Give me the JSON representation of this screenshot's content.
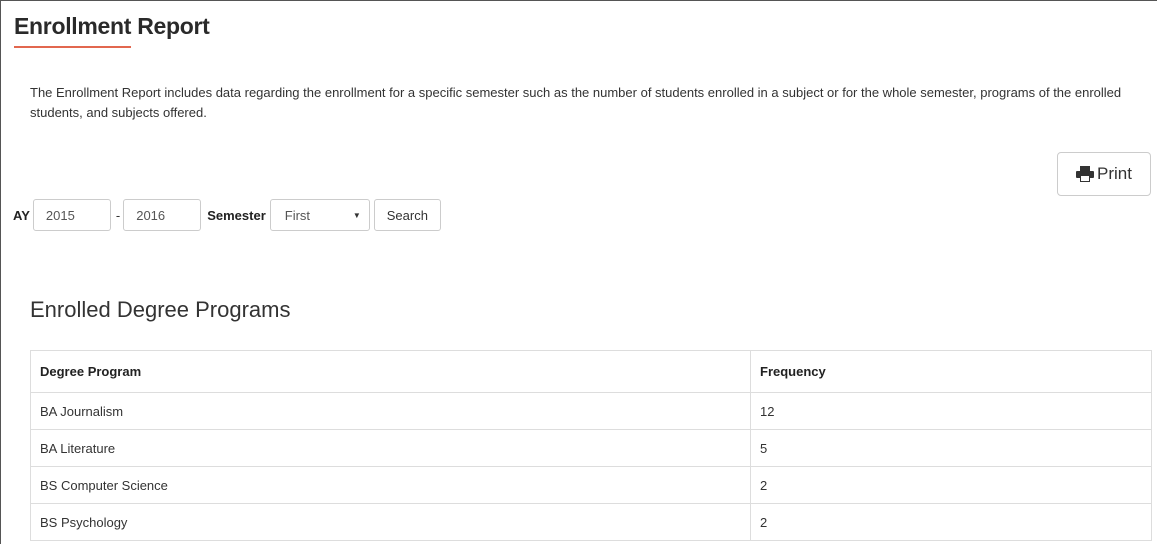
{
  "page": {
    "title": "Enrollment Report",
    "description": "The Enrollment Report includes data regarding the enrollment for a specific semester such as the number of students enrolled in a subject or for the whole semester, programs of the enrolled students, and subjects offered."
  },
  "toolbar": {
    "print_label": "Print",
    "print_icon": "printer-icon"
  },
  "filters": {
    "ay_label": "AY",
    "year_start": "2015",
    "separator": "-",
    "year_end": "2016",
    "semester_label": "Semester",
    "semester_value": "First",
    "search_label": "Search"
  },
  "programs": {
    "heading": "Enrolled Degree Programs",
    "columns": [
      "Degree Program",
      "Frequency"
    ],
    "rows": [
      {
        "program": "BA Journalism",
        "frequency": "12"
      },
      {
        "program": "BA Literature",
        "frequency": "5"
      },
      {
        "program": "BS Computer Science",
        "frequency": "2"
      },
      {
        "program": "BS Psychology",
        "frequency": "2"
      }
    ]
  },
  "colors": {
    "accent_underline": "#e2674f",
    "border": "#dddddd"
  }
}
